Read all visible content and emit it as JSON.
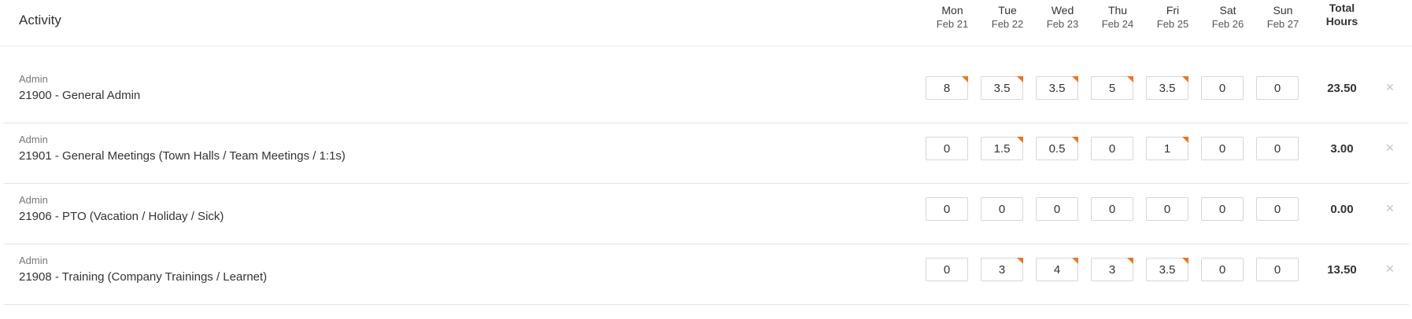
{
  "header": {
    "activity_label": "Activity",
    "days": [
      {
        "name": "Mon",
        "date": "Feb 21"
      },
      {
        "name": "Tue",
        "date": "Feb 22"
      },
      {
        "name": "Wed",
        "date": "Feb 23"
      },
      {
        "name": "Thu",
        "date": "Feb 24"
      },
      {
        "name": "Fri",
        "date": "Feb 25"
      },
      {
        "name": "Sat",
        "date": "Feb 26"
      },
      {
        "name": "Sun",
        "date": "Feb 27"
      }
    ],
    "total_label_line1": "Total",
    "total_label_line2": "Hours"
  },
  "rows": [
    {
      "category": "Admin",
      "name": "21900 - General Admin",
      "hours": [
        "8",
        "3.5",
        "3.5",
        "5",
        "3.5",
        "0",
        "0"
      ],
      "flagged": [
        true,
        true,
        true,
        true,
        true,
        false,
        false
      ],
      "total": "23.50",
      "remove_icon": "×"
    },
    {
      "category": "Admin",
      "name": "21901 - General Meetings (Town Halls / Team Meetings / 1:1s)",
      "hours": [
        "0",
        "1.5",
        "0.5",
        "0",
        "1",
        "0",
        "0"
      ],
      "flagged": [
        false,
        true,
        true,
        false,
        true,
        false,
        false
      ],
      "total": "3.00",
      "remove_icon": "×"
    },
    {
      "category": "Admin",
      "name": "21906 - PTO (Vacation / Holiday / Sick)",
      "hours": [
        "0",
        "0",
        "0",
        "0",
        "0",
        "0",
        "0"
      ],
      "flagged": [
        false,
        false,
        false,
        false,
        false,
        false,
        false
      ],
      "total": "0.00",
      "remove_icon": "×"
    },
    {
      "category": "Admin",
      "name": "21908 - Training (Company Trainings / Learnet)",
      "hours": [
        "0",
        "3",
        "4",
        "3",
        "3.5",
        "0",
        "0"
      ],
      "flagged": [
        false,
        true,
        true,
        true,
        true,
        false,
        false
      ],
      "total": "13.50",
      "remove_icon": "×"
    }
  ],
  "colors": {
    "flag": "#e87722",
    "border": "#d6d6d6",
    "divider": "#e3e3e3",
    "remove_icon": "#c4c4c4"
  }
}
